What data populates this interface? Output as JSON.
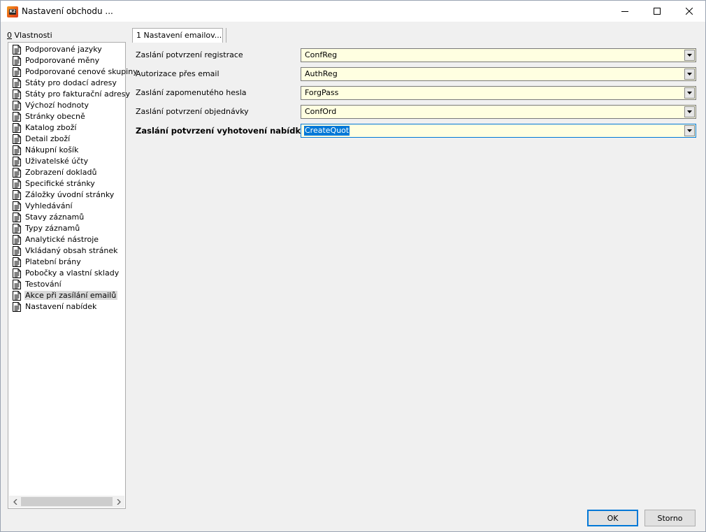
{
  "window": {
    "title": "Nastavení obchodu ...",
    "icon_text": "K2"
  },
  "properties": {
    "hotkey": "0",
    "label": " Vlastnosti"
  },
  "tree": {
    "items": [
      {
        "label": "Podporované jazyky"
      },
      {
        "label": "Podporované měny"
      },
      {
        "label": "Podporované cenové skupiny"
      },
      {
        "label": "Státy pro dodací adresy"
      },
      {
        "label": "Státy pro fakturační adresy"
      },
      {
        "label": "Výchozí hodnoty"
      },
      {
        "label": "Stránky obecně"
      },
      {
        "label": "Katalog zboží"
      },
      {
        "label": "Detail zboží"
      },
      {
        "label": "Nákupní košík"
      },
      {
        "label": "Uživatelské účty"
      },
      {
        "label": "Zobrazení dokladů"
      },
      {
        "label": "Specifické stránky"
      },
      {
        "label": "Záložky úvodní stránky"
      },
      {
        "label": "Vyhledávání"
      },
      {
        "label": "Stavy záznamů"
      },
      {
        "label": "Typy záznamů"
      },
      {
        "label": "Analytické nástroje"
      },
      {
        "label": "Vkládaný obsah stránek"
      },
      {
        "label": "Platební brány"
      },
      {
        "label": "Pobočky a vlastní sklady"
      },
      {
        "label": "Testování"
      },
      {
        "label": "Akce při zasílání emailů",
        "selected": true
      },
      {
        "label": "Nastavení nabídek"
      }
    ]
  },
  "tab": {
    "label": "1 Nastavení emailov..."
  },
  "form": {
    "fields": [
      {
        "label": "Zaslání potvrzení registrace",
        "value": "ConfReg"
      },
      {
        "label": "Autorizace přes email",
        "value": "AuthReg"
      },
      {
        "label": "Zaslání zapomenutého hesla",
        "value": "ForgPass"
      },
      {
        "label": "Zaslání potvrzení objednávky",
        "value": "ConfOrd"
      },
      {
        "label": "Zaslání potvrzení vyhotovení nabídky",
        "value": "CreateQuot",
        "focused": true
      }
    ]
  },
  "buttons": {
    "ok": "OK",
    "cancel": "Storno"
  },
  "colors": {
    "field_bg": "#ffffe1",
    "selection": "#0078d7",
    "tree_selected": "#d9d9d9"
  }
}
